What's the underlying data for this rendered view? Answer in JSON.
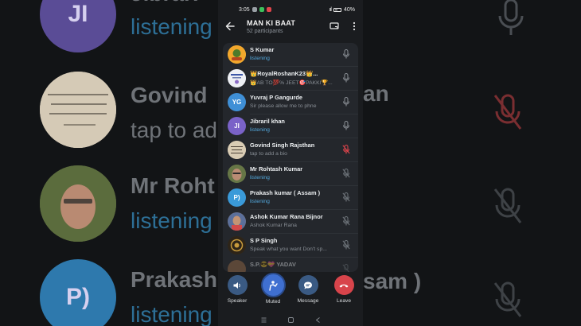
{
  "status_bar": {
    "time": "3:05",
    "battery": "40%"
  },
  "header": {
    "title": "MAN KI BAAT",
    "subtitle": "52 participants"
  },
  "participants": [
    {
      "name": "S Kumar",
      "status": "listening",
      "status_type": "listening",
      "avatar_initials": "",
      "avatar_color": "#f0a828",
      "mic": "on"
    },
    {
      "name": "👑RoyalRoshanK23👑...",
      "status": "👑AB TO💯% JEET🎯PAKKI🏆...",
      "status_type": "bio",
      "avatar_initials": "",
      "avatar_color": "#e9ecf3",
      "mic": "on"
    },
    {
      "name": "Yuvraj P Gangurde",
      "status": "Sir please allow me to phne",
      "status_type": "bio",
      "avatar_initials": "YG",
      "avatar_color": "#3f8fd6",
      "mic": "on"
    },
    {
      "name": "Jibraril khan",
      "status": "listening",
      "status_type": "listening",
      "avatar_initials": "JI",
      "avatar_color": "#7a62c8",
      "mic": "on"
    },
    {
      "name": "Govind Singh Rajsthan",
      "status": "tap to add a bio",
      "status_type": "bio",
      "avatar_initials": "",
      "avatar_color": "#d7c9b0",
      "mic": "muted-red"
    },
    {
      "name": "Mr Rohtash Kumar",
      "status": "listening",
      "status_type": "listening",
      "avatar_initials": "",
      "avatar_color": "#6b7a48",
      "mic": "muted"
    },
    {
      "name": "Prakash kumar ( Assam )",
      "status": "listening",
      "status_type": "listening",
      "avatar_initials": "P)",
      "avatar_color": "#3a9ad9",
      "mic": "muted"
    },
    {
      "name": "Ashok Kumar Rana Bijnor",
      "status": "Ashok Kumar Rana",
      "status_type": "bio",
      "avatar_initials": "",
      "avatar_color": "#8a6f5a",
      "mic": "muted"
    },
    {
      "name": "S P Singh",
      "status": "Speak what you want Don't sp...",
      "status_type": "bio",
      "avatar_initials": "",
      "avatar_color": "#3a2f1c",
      "mic": "muted"
    },
    {
      "name": "S.P.😎💝 YADAV",
      "status": "",
      "status_type": "bio",
      "avatar_initials": "",
      "avatar_color": "#a06f48",
      "mic": "muted"
    }
  ],
  "controls": {
    "speaker": "Speaker",
    "muted": "Muted",
    "message": "Message",
    "leave": "Leave"
  },
  "background": {
    "rows": [
      {
        "name": "Jibrari",
        "status": "listening",
        "initials": "JI"
      },
      {
        "name": "Govind",
        "status": "tap to add",
        "initials": ""
      },
      {
        "name": "Mr Roht",
        "status": "listening",
        "initials": ""
      },
      {
        "name": "Prakash",
        "status": "listening",
        "initials": "P)"
      }
    ],
    "right_fragments": {
      "r1": "an",
      "r2": "sam )"
    }
  },
  "colors": {
    "accent_blue": "#53a9de",
    "muted_red": "#e0454c",
    "leave_red": "#d8444b",
    "speaker_btn": "#3a5a83",
    "muted_btn": "#3f6fd0",
    "message_btn": "#3a5a83"
  }
}
